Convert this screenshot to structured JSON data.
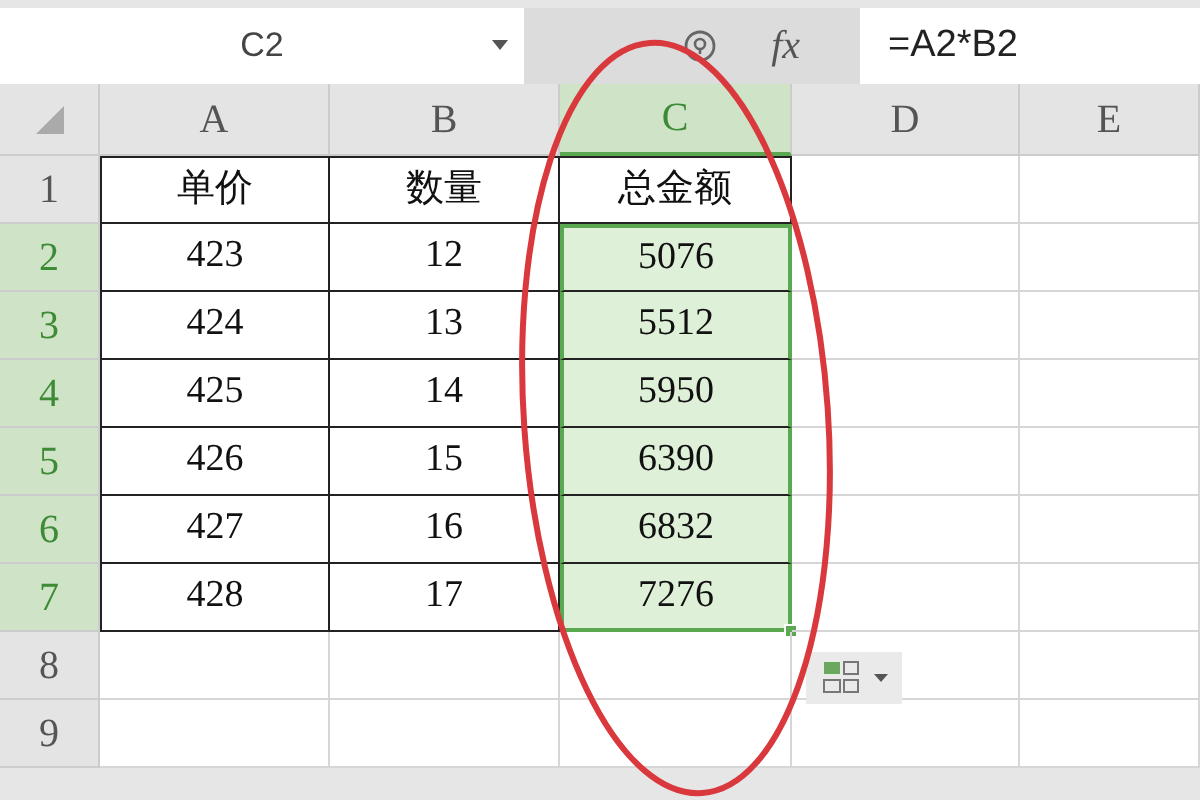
{
  "name_box": "C2",
  "function_label": "fx",
  "formula": "=A2*B2",
  "columns": [
    {
      "label": "A",
      "selected": false
    },
    {
      "label": "B",
      "selected": false
    },
    {
      "label": "C",
      "selected": true
    },
    {
      "label": "D",
      "selected": false
    },
    {
      "label": "E",
      "selected": false
    }
  ],
  "rows": [
    {
      "number": "1",
      "selected": false,
      "cells": [
        "单价",
        "数量",
        "总金额"
      ]
    },
    {
      "number": "2",
      "selected": true,
      "cells": [
        "423",
        "12",
        "5076"
      ]
    },
    {
      "number": "3",
      "selected": true,
      "cells": [
        "424",
        "13",
        "5512"
      ]
    },
    {
      "number": "4",
      "selected": true,
      "cells": [
        "425",
        "14",
        "5950"
      ]
    },
    {
      "number": "5",
      "selected": true,
      "cells": [
        "426",
        "15",
        "6390"
      ]
    },
    {
      "number": "6",
      "selected": true,
      "cells": [
        "427",
        "16",
        "6832"
      ]
    },
    {
      "number": "7",
      "selected": true,
      "cells": [
        "428",
        "17",
        "7276"
      ]
    },
    {
      "number": "8",
      "selected": false,
      "cells": []
    },
    {
      "number": "9",
      "selected": false,
      "cells": []
    }
  ]
}
